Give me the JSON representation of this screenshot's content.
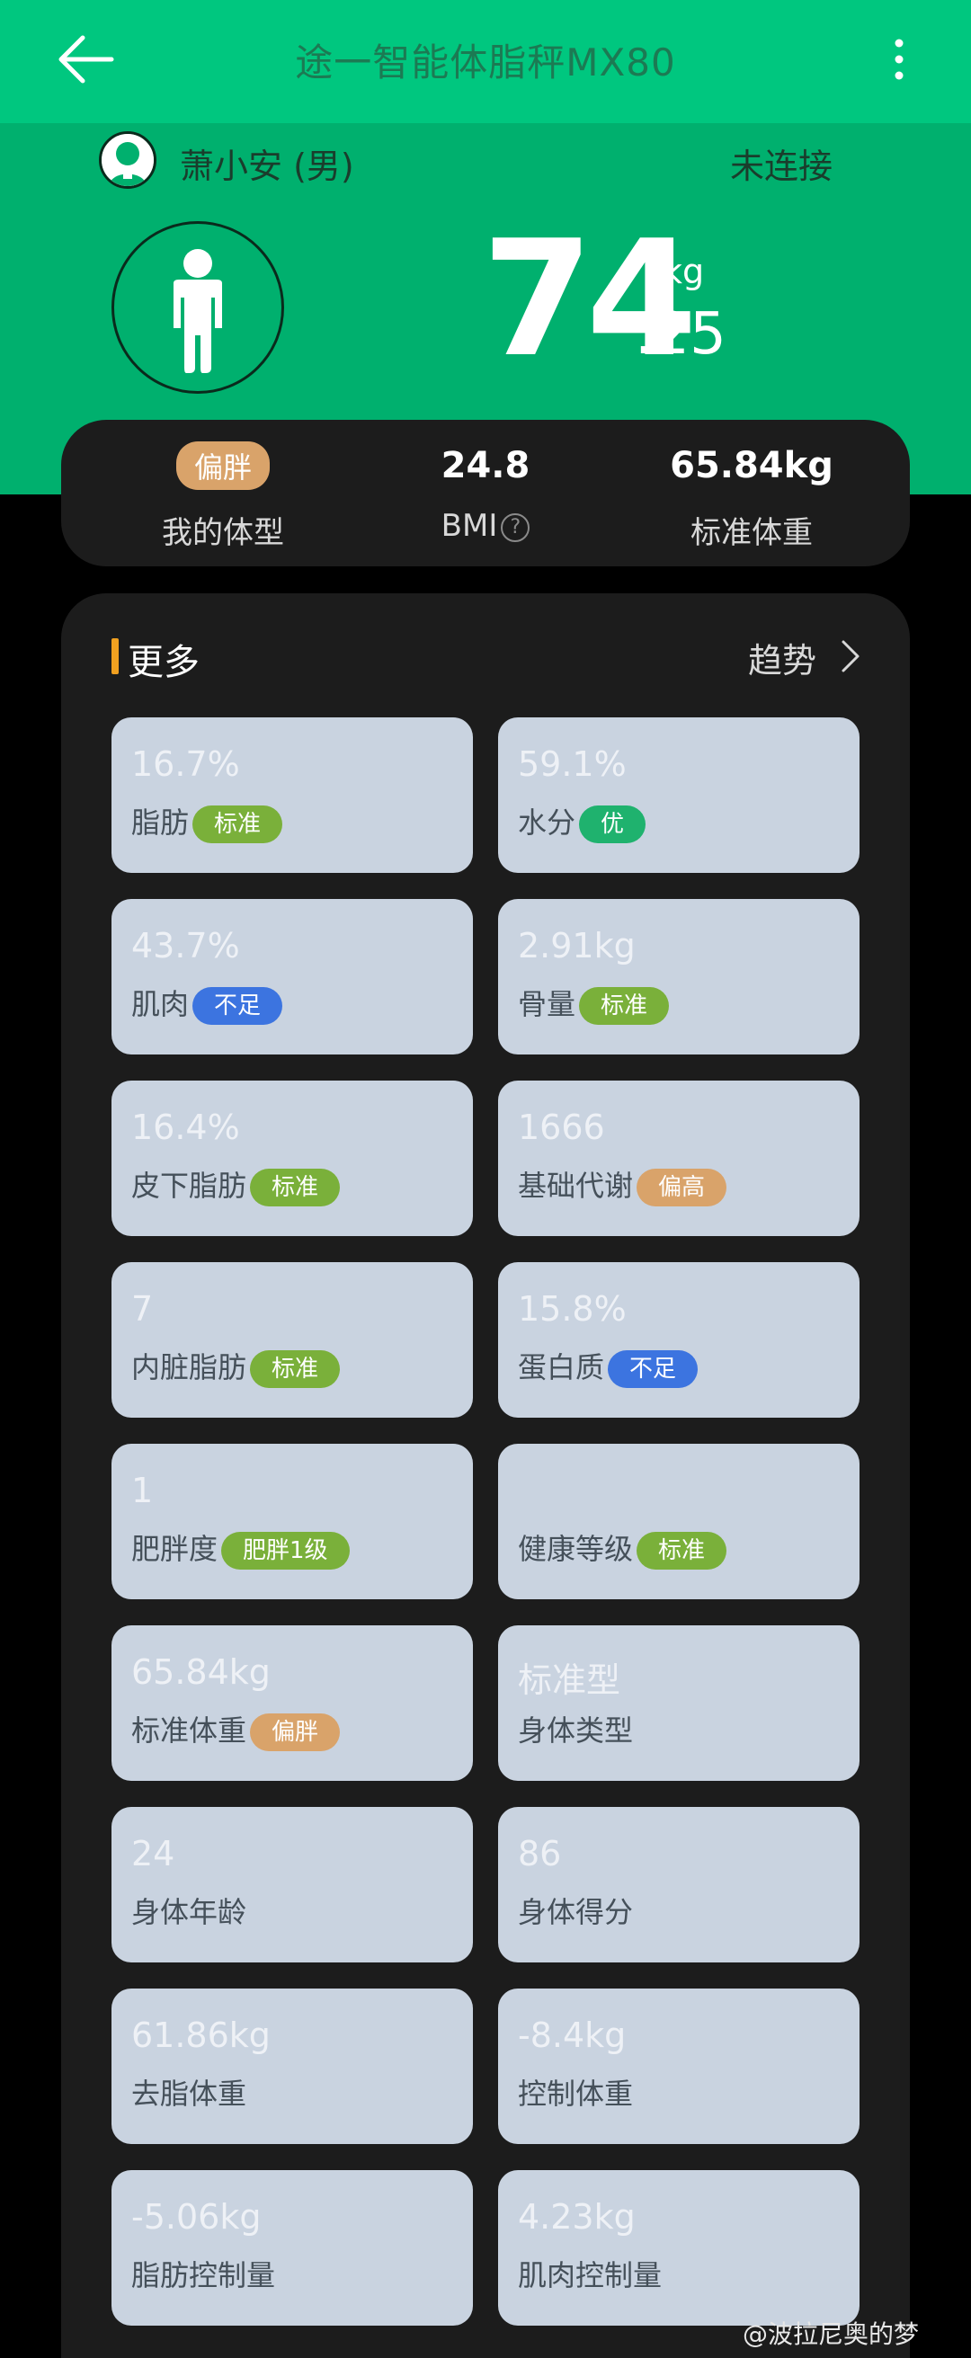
{
  "header": {
    "title": "途一智能体脂秤MX80",
    "back_icon": "arrow-left-icon",
    "menu_icon": "more-vertical-icon"
  },
  "user": {
    "name": "萧小安 (男)",
    "connection_status": "未连接"
  },
  "weight": {
    "integer": "74",
    "decimal": ".25",
    "unit": "kg"
  },
  "summary": {
    "body_type_badge": "偏胖",
    "body_type_label": "我的体型",
    "bmi_value": "24.8",
    "bmi_label": "BMI",
    "standard_weight_value": "65.84kg",
    "standard_weight_label": "标准体重"
  },
  "more": {
    "title": "更多",
    "trend_label": "趋势"
  },
  "metrics": [
    {
      "value": "16.7%",
      "label": "脂肪",
      "badge": "标准",
      "badge_color": "#7ab03a"
    },
    {
      "value": "59.1%",
      "label": "水分",
      "badge": "优",
      "badge_color": "#1fb26e"
    },
    {
      "value": "43.7%",
      "label": "肌肉",
      "badge": "不足",
      "badge_color": "#3c74e0"
    },
    {
      "value": "2.91kg",
      "label": "骨量",
      "badge": "标准",
      "badge_color": "#7ab03a"
    },
    {
      "value": "16.4%",
      "label": "皮下脂肪",
      "badge": "标准",
      "badge_color": "#7ab03a"
    },
    {
      "value": "1666",
      "label": "基础代谢",
      "badge": "偏高",
      "badge_color": "#d9a36a"
    },
    {
      "value": "7",
      "label": "内脏脂肪",
      "badge": "标准",
      "badge_color": "#7ab03a"
    },
    {
      "value": "15.8%",
      "label": "蛋白质",
      "badge": "不足",
      "badge_color": "#3c74e0"
    },
    {
      "value": "1",
      "label": "肥胖度",
      "badge": "肥胖1级",
      "badge_color": "#7ab03a"
    },
    {
      "value": "",
      "label": "健康等级",
      "badge": "标准",
      "badge_color": "#7ab03a"
    },
    {
      "value": "65.84kg",
      "label": "标准体重",
      "badge": "偏胖",
      "badge_color": "#d9a36a"
    },
    {
      "value": "标准型",
      "label": "身体类型",
      "badge": "",
      "badge_color": ""
    },
    {
      "value": "24",
      "label": "身体年龄",
      "badge": "",
      "badge_color": ""
    },
    {
      "value": "86",
      "label": "身体得分",
      "badge": "",
      "badge_color": ""
    },
    {
      "value": "61.86kg",
      "label": "去脂体重",
      "badge": "",
      "badge_color": ""
    },
    {
      "value": "-8.4kg",
      "label": "控制体重",
      "badge": "",
      "badge_color": ""
    },
    {
      "value": "-5.06kg",
      "label": "脂肪控制量",
      "badge": "",
      "badge_color": ""
    },
    {
      "value": "4.23kg",
      "label": "肌肉控制量",
      "badge": "",
      "badge_color": ""
    }
  ],
  "watermark": "@波拉尼奥的梦",
  "colors": {
    "primary": "#00c77f",
    "hero": "#00b06e",
    "card": "#1c1c1c",
    "tile": "#c9d3e0",
    "accent_bar": "#f0a020"
  }
}
